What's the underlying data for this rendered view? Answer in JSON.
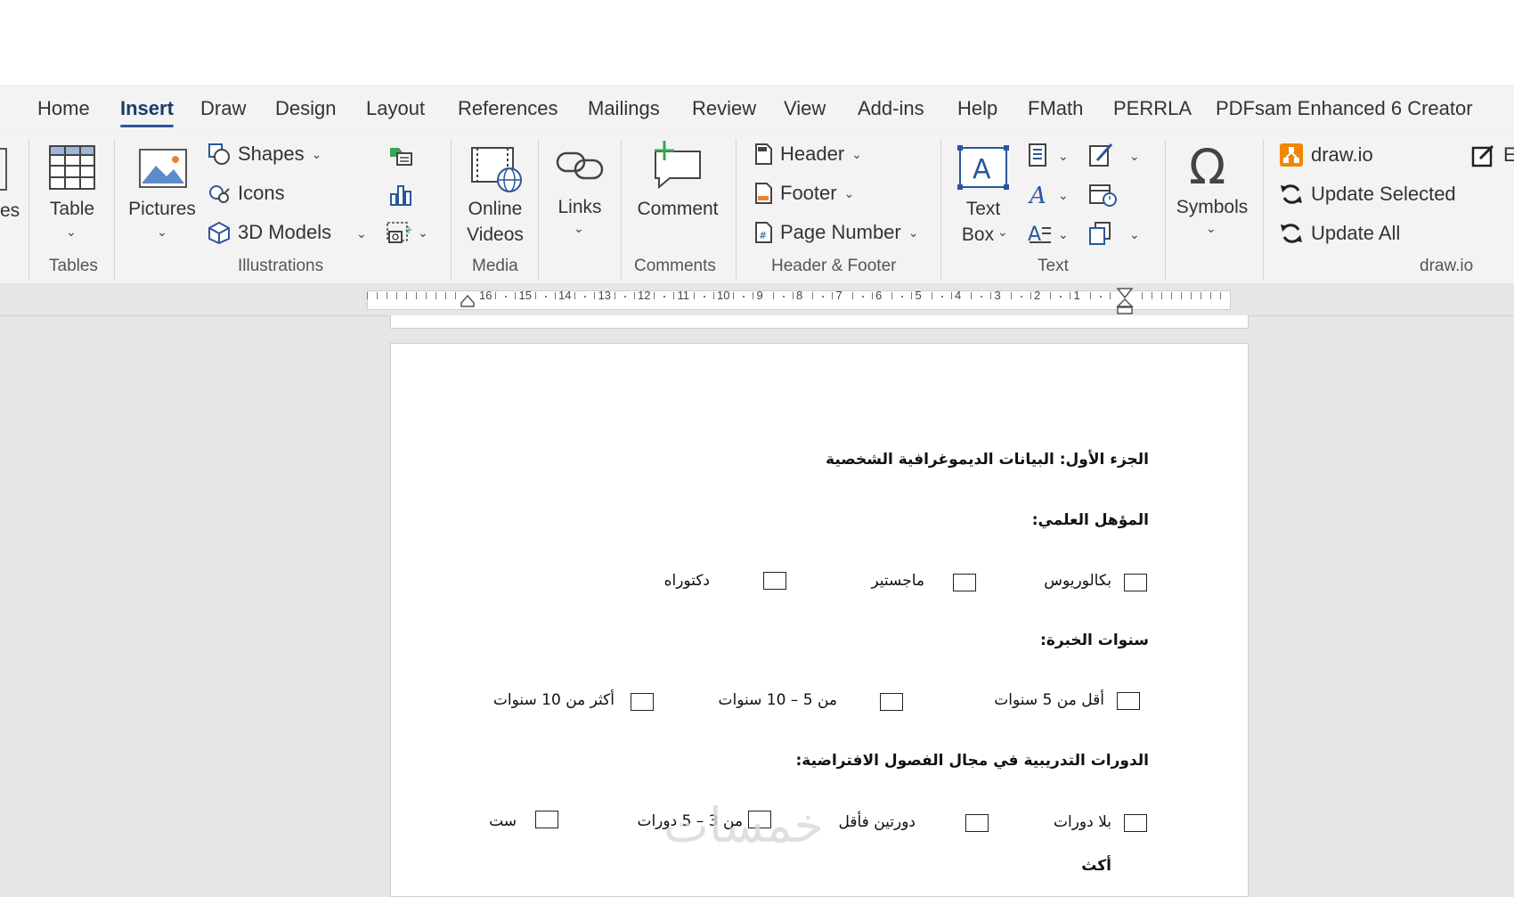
{
  "tabs": [
    "Home",
    "Insert",
    "Draw",
    "Design",
    "Layout",
    "References",
    "Mailings",
    "Review",
    "View",
    "Add-ins",
    "Help",
    "FMath",
    "PERRLA",
    "PDFsam Enhanced 6 Creator"
  ],
  "active_tab": "Insert",
  "ribbon": {
    "cut_left_label": "es",
    "tables": {
      "table_label": "Table",
      "group": "Tables"
    },
    "illustrations": {
      "pictures_label": "Pictures",
      "shapes_label": "Shapes",
      "icons_label": "Icons",
      "models_label": "3D Models",
      "group": "Illustrations"
    },
    "media": {
      "online_line1": "Online",
      "online_line2": "Videos",
      "group": "Media"
    },
    "links": {
      "label": "Links"
    },
    "comments": {
      "comment_label": "Comment",
      "group": "Comments"
    },
    "header_footer": {
      "header_label": "Header",
      "footer_label": "Footer",
      "page_number_label": "Page Number",
      "group": "Header & Footer"
    },
    "text": {
      "textbox_line1": "Text",
      "textbox_line2": "Box",
      "group": "Text"
    },
    "symbols": {
      "label": "Symbols"
    },
    "drawio": {
      "drawio_label": "draw.io",
      "update_selected_label": "Update Selected",
      "update_all_label": "Update All",
      "group": "draw.io",
      "cut_right_label": "E"
    }
  },
  "ruler": {
    "numbers": [
      "16",
      "15",
      "14",
      "13",
      "12",
      "11",
      "10",
      "9",
      "8",
      "7",
      "6",
      "5",
      "4",
      "3",
      "2",
      "1"
    ]
  },
  "document": {
    "part_title": "الجزء الأول: البيانات الديموغرافية الشخصية",
    "q1_title": "المؤهل العلمي:",
    "q1_options": [
      "بكالوريوس",
      "ماجستير",
      "دكتوراه"
    ],
    "q2_title": "سنوات الخبرة:",
    "q2_options": [
      "أقل من 5 سنوات",
      "من 5 – 10 سنوات",
      "أكثر من 10 سنوات"
    ],
    "q3_title": "الدورات التدريبية في مجال الفصول الافتراضية:",
    "q3_options": [
      "بلا دورات",
      "دورتين فأقل",
      "من 3 – 5 دورات",
      "ست"
    ],
    "partial_next": "أكث"
  },
  "watermark": "خمسات",
  "colors": {
    "accent": "#2b579a",
    "ribbon_bg": "#f3f3f3",
    "canvas_bg": "#e6e6e6",
    "drawio_orange": "#f08705"
  }
}
